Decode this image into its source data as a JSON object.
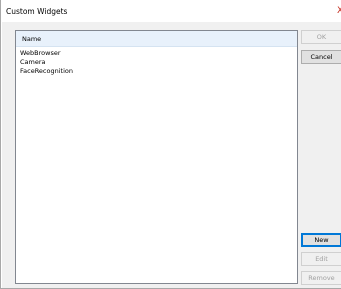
{
  "window": {
    "title": "Custom Widgets",
    "close_glyph": "X"
  },
  "list": {
    "header": "Name",
    "items": [
      "WebBrowser",
      "Camera",
      "FaceRecognition"
    ]
  },
  "buttons": {
    "ok": "OK",
    "cancel": "Cancel",
    "new": "New",
    "edit": "Edit",
    "remove": "Remove"
  }
}
